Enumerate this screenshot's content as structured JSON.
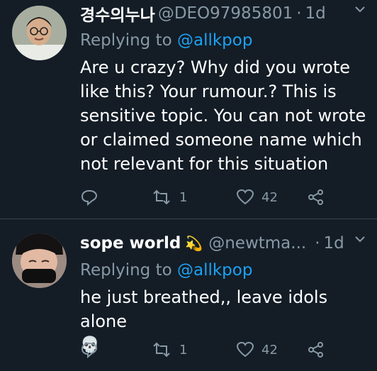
{
  "tweets": [
    {
      "name": "경수의누나",
      "handle": "@DEO97985801",
      "dot": "·",
      "time": "1d",
      "reply_prefix": "Replying to",
      "reply_to": "@allkpop",
      "text": "Are u crazy?  Why did you wrote like this? Your rumour.? This is sensitive topic. You can not wrote or claimed someone name which not relevant for this situation",
      "retweets": "1",
      "likes": "42"
    },
    {
      "name": "sope world",
      "emoji": "💫",
      "handle": "@newtma...",
      "dot": "·",
      "time": "1d",
      "reply_prefix": "Replying to",
      "reply_to": "@allkpop",
      "text": "he just breathed,, leave idols alone",
      "text_emoji": "💀",
      "retweets": "1",
      "likes": "42"
    }
  ],
  "colors": {
    "background": "#141d26",
    "muted": "#8899a6",
    "link": "#1da1f2",
    "divider": "#38444d"
  }
}
